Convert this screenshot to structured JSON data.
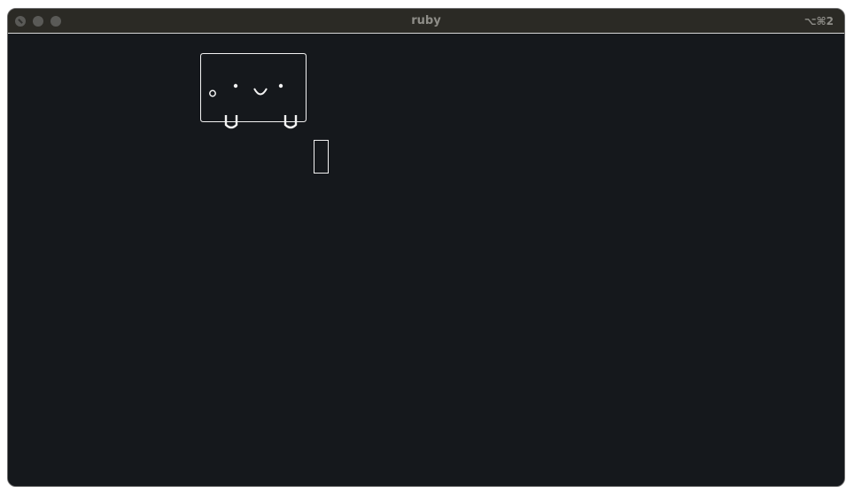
{
  "window": {
    "title": "ruby",
    "shortcut": "⌥⌘2"
  },
  "colors": {
    "titlebar": "#2b2a25",
    "terminal_bg": "#15181c",
    "foreground": "#f2f2f2",
    "title_text": "#8e8d88",
    "traffic_light": "#5a5a57"
  },
  "terminal": {
    "mascot_icon": "ascii-box-face-mascot",
    "cursor_style": "block-outline"
  }
}
